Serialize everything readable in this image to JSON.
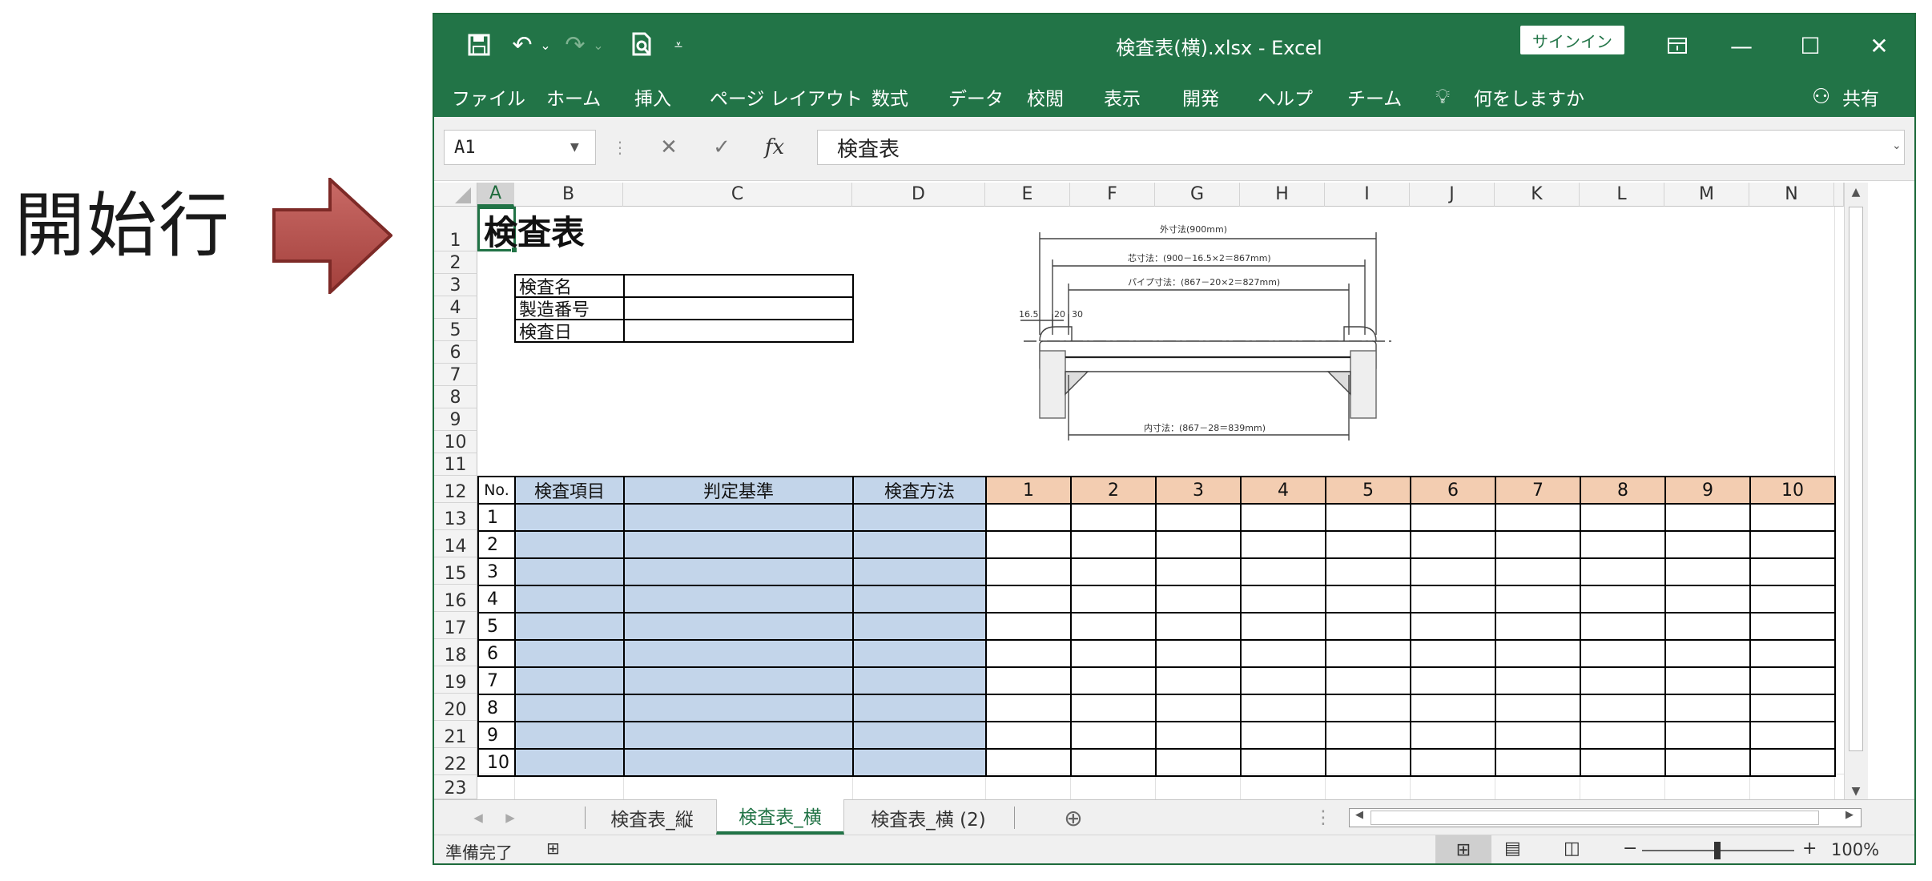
{
  "annotation": {
    "label": "開始行",
    "arrow_color": "#b85450"
  },
  "window": {
    "title": "検査表(横).xlsx  -  Excel",
    "signin_label": "サインイン",
    "qat": {
      "save": "save-icon",
      "undo": "undo-icon",
      "redo": "redo-icon",
      "preview": "print-preview-icon",
      "customize": "customize-qat-icon"
    }
  },
  "menu": {
    "items": [
      "ファイル",
      "ホーム",
      "挿入",
      "ページ レイアウト",
      "数式",
      "データ",
      "校閲",
      "表示",
      "開発",
      "ヘルプ",
      "チーム"
    ],
    "tell_me": "何をしますか",
    "share": "共有"
  },
  "formula_bar": {
    "name_box": "A1",
    "formula": "検査表"
  },
  "columns": [
    "A",
    "B",
    "C",
    "D",
    "E",
    "F",
    "G",
    "H",
    "I",
    "J",
    "K",
    "L",
    "M",
    "N"
  ],
  "rows": [
    "1",
    "2",
    "3",
    "4",
    "5",
    "6",
    "7",
    "8",
    "9",
    "10",
    "11",
    "12",
    "13",
    "14",
    "15",
    "16",
    "17",
    "18",
    "19",
    "20",
    "21",
    "22",
    "23"
  ],
  "sheet": {
    "title": "検査表",
    "info_labels": [
      "検査名",
      "製造番号",
      "検査日"
    ],
    "table_headers": {
      "no": "No.",
      "item": "検査項目",
      "criteria": "判定基準",
      "method": "検査方法"
    },
    "inspection_cols": [
      "1",
      "2",
      "3",
      "4",
      "5",
      "6",
      "7",
      "8",
      "9",
      "10"
    ],
    "row_numbers": [
      "1",
      "2",
      "3",
      "4",
      "5",
      "6",
      "7",
      "8",
      "9",
      "10"
    ]
  },
  "drawing": {
    "outer": "外寸法(900mm)",
    "core": "芯寸法：(900－16.5×2＝867mm)",
    "pipe": "パイプ寸法：(867－20×2＝827mm)",
    "inner": "内寸法：(867－28＝839mm)",
    "d1": "16.5",
    "d2": "20",
    "d3": "30"
  },
  "tabs": [
    "検査表_縦",
    "検査表_横",
    "検査表_横 (2)"
  ],
  "active_tab": "検査表_横",
  "status": {
    "ready": "準備完了",
    "zoom": "100%"
  },
  "colors": {
    "ribbon": "#227447",
    "header_blue": "#c3d5ea",
    "header_orange": "#f3cdb1"
  }
}
